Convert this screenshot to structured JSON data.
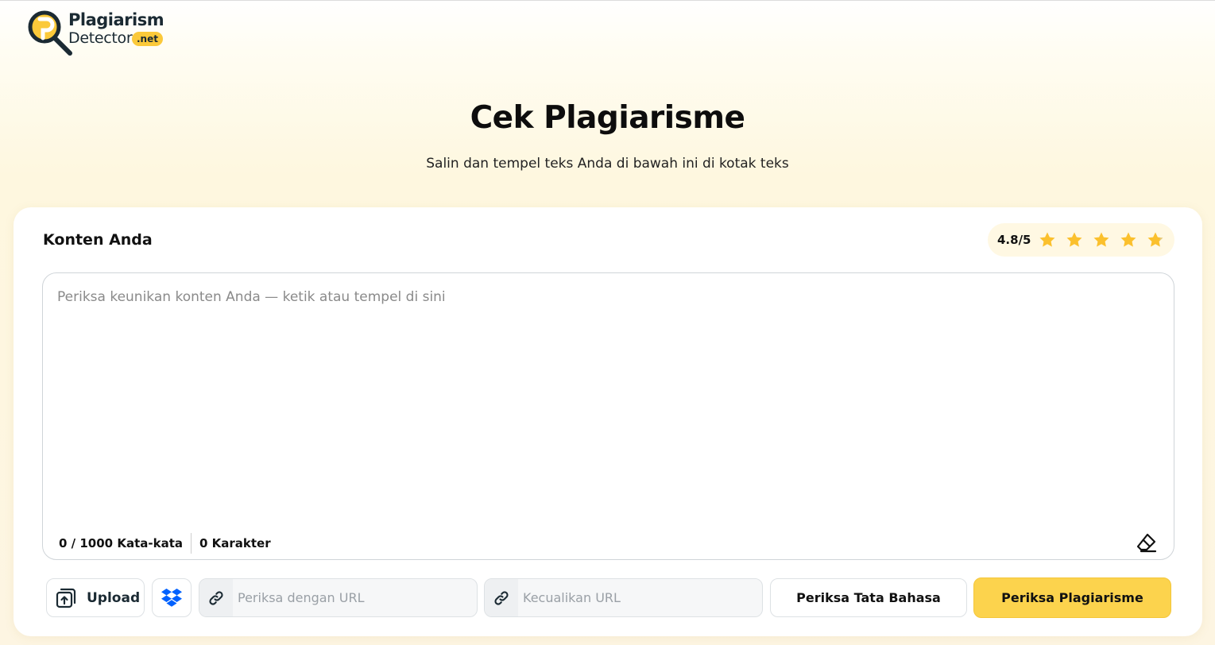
{
  "brand": {
    "name_line1": "Plagiarism",
    "name_line2": "Detector",
    "badge": ".net",
    "accent": "#fbc93a"
  },
  "hero": {
    "title": "Cek Plagiarisme",
    "subtitle": "Salin dan tempel teks Anda di bawah ini di kotak teks"
  },
  "card": {
    "title": "Konten Anda",
    "rating": {
      "text": "4.8/5",
      "value": 4.8,
      "max": 5,
      "stars": 5,
      "star_color": "#fbc02d"
    },
    "editor": {
      "placeholder": "Periksa keunikan konten Anda — ketik atau tempel di sini",
      "words": "0 / 1000 Kata-kata",
      "chars": "0 Karakter",
      "clear_icon": "eraser-icon"
    }
  },
  "actions": {
    "upload_label": "Upload",
    "upload_icon": "upload-icon",
    "dropbox_icon": "dropbox-icon",
    "check_url_placeholder": "Periksa dengan URL",
    "exclude_url_placeholder": "Kecualikan URL",
    "link_icon": "link-icon",
    "grammar_label": "Periksa Tata Bahasa",
    "plagiarism_label": "Periksa Plagiarisme",
    "primary_color": "#fcd34d",
    "dropbox_color": "#0061fe"
  }
}
